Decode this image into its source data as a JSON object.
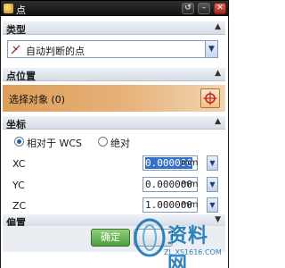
{
  "window": {
    "title": "点",
    "buttons": [
      "↺",
      "–",
      "✕"
    ]
  },
  "sections": {
    "type": {
      "label": "类型",
      "selected": "自动判断的点"
    },
    "point_location": {
      "label": "点位置",
      "select_object": "选择对象 (0)"
    },
    "coordinates": {
      "label": "坐标",
      "radio_options": [
        "相对于 WCS",
        "绝对"
      ],
      "selected_option": "相对于 WCS",
      "fields": [
        {
          "label": "XC",
          "value": "0.000000",
          "unit": "mm"
        },
        {
          "label": "YC",
          "value": "0.000000",
          "unit": "mm"
        },
        {
          "label": "ZC",
          "value": "1.000000",
          "unit": "mm"
        }
      ]
    },
    "offset": {
      "label": "偏置"
    }
  },
  "footer": {
    "ok_label": "确定",
    "other_label": ""
  },
  "watermark": {
    "big": "资料网",
    "small": "ZL.XS1616.COM"
  },
  "colors": {
    "accent": "#dc9e58",
    "selection": "#3470c8",
    "titlebar": "#1b1b1b"
  },
  "icons": {
    "window": "point-dialog-icon",
    "type_option": "snap-point-icon",
    "select_button": "crosshair-target-icon"
  }
}
